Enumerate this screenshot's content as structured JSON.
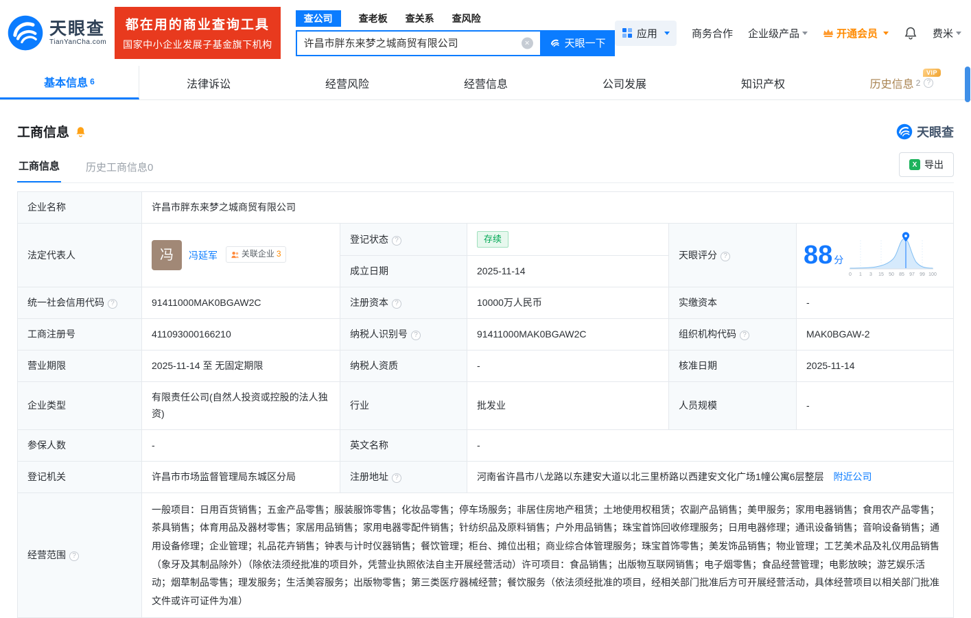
{
  "header": {
    "logo": {
      "brand": "天眼查",
      "domain": "TianYanCha.com"
    },
    "banner": {
      "line1": "都在用的商业查询工具",
      "line2": "国家中小企业发展子基金旗下机构"
    },
    "search": {
      "tabs": [
        {
          "label": "查公司"
        },
        {
          "label": "查老板"
        },
        {
          "label": "查关系"
        },
        {
          "label": "查风险"
        }
      ],
      "value": "许昌市胖东来梦之城商贸有限公司",
      "button": "天眼一下"
    },
    "nav": {
      "apps": "应用",
      "cooperation": "商务合作",
      "enterprise": "企业级产品",
      "vip": "开通会员",
      "user": "费米"
    }
  },
  "nav_tabs": [
    {
      "label": "基本信息",
      "count": "6"
    },
    {
      "label": "法律诉讼"
    },
    {
      "label": "经营风险"
    },
    {
      "label": "经营信息"
    },
    {
      "label": "公司发展"
    },
    {
      "label": "知识产权"
    },
    {
      "label": "历史信息",
      "count": "2",
      "vip": "VIP"
    }
  ],
  "section": {
    "title": "工商信息",
    "watermark": "天眼查",
    "subtabs": [
      "工商信息",
      "历史工商信息0"
    ],
    "export": "导出"
  },
  "fields": {
    "company_name": {
      "label": "企业名称",
      "value": "许昌市胖东来梦之城商贸有限公司"
    },
    "legal_rep": {
      "label": "法定代表人",
      "avatar": "冯",
      "name": "冯延军",
      "related": "关联企业",
      "related_count": "3"
    },
    "reg_status": {
      "label": "登记状态",
      "value": "存续"
    },
    "establish_date": {
      "label": "成立日期",
      "value": "2025-11-14"
    },
    "score": {
      "label": "天眼评分",
      "value": "88",
      "unit": "分"
    },
    "credit_code": {
      "label": "统一社会信用代码",
      "value": "91411000MAK0BGAW2C"
    },
    "reg_capital": {
      "label": "注册资本",
      "value": "10000万人民币"
    },
    "paid_capital": {
      "label": "实缴资本",
      "value": "-"
    },
    "reg_number": {
      "label": "工商注册号",
      "value": "411093000166210"
    },
    "taxpayer_id": {
      "label": "纳税人识别号",
      "value": "91411000MAK0BGAW2C"
    },
    "org_code": {
      "label": "组织机构代码",
      "value": "MAK0BGAW-2"
    },
    "business_term": {
      "label": "营业期限",
      "value": "2025-11-14 至 无固定期限"
    },
    "taxpayer_quality": {
      "label": "纳税人资质",
      "value": "-"
    },
    "approval_date": {
      "label": "核准日期",
      "value": "2025-11-14"
    },
    "company_type": {
      "label": "企业类型",
      "value": "有限责任公司(自然人投资或控股的法人独资)"
    },
    "industry": {
      "label": "行业",
      "value": "批发业"
    },
    "staff_size": {
      "label": "人员规模",
      "value": "-"
    },
    "insured_count": {
      "label": "参保人数",
      "value": "-"
    },
    "english_name": {
      "label": "英文名称",
      "value": "-"
    },
    "reg_authority": {
      "label": "登记机关",
      "value": "许昌市市场监督管理局东城区分局"
    },
    "reg_address": {
      "label": "注册地址",
      "value": "河南省许昌市八龙路以东建安大道以北三里桥路以西建安文化广场1幢公寓6层整层",
      "link": "附近公司"
    },
    "business_scope": {
      "label": "经营范围",
      "value": "一般项目：日用百货销售；五金产品零售；服装服饰零售；化妆品零售；停车场服务；非居住房地产租赁；土地使用权租赁；农副产品销售；美甲服务；家用电器销售；食用农产品零售；茶具销售；体育用品及器材零售；家居用品销售；家用电器零配件销售；针纺织品及原料销售；户外用品销售；珠宝首饰回收修理服务；日用电器修理；通讯设备销售；音响设备销售；通用设备修理；企业管理；礼品花卉销售；钟表与计时仪器销售；餐饮管理；柜台、摊位出租；商业综合体管理服务；珠宝首饰零售；美发饰品销售；物业管理；工艺美术品及礼仪用品销售（象牙及其制品除外）（除依法须经批准的项目外，凭营业执照依法自主开展经营活动）许可项目：食品销售；出版物互联网销售；电子烟零售；食品经营管理；电影放映；游艺娱乐活动；烟草制品零售；理发服务；生活美容服务；出版物零售；第三类医疗器械经营；餐饮服务（依法须经批准的项目，经相关部门批准后方可开展经营活动，具体经营项目以相关部门批准文件或许可证件为准）"
    }
  },
  "score_chart": {
    "ticks": [
      "0",
      "1",
      "3",
      "15",
      "50",
      "85",
      "97",
      "99",
      "100"
    ],
    "marker_value": "88"
  },
  "icons": {
    "help": "?",
    "clear": "×",
    "excel": "X"
  },
  "colors": {
    "brand_blue": "#0b7cff",
    "banner_red": "#e83a1e",
    "status_green": "#00a854",
    "vip_orange": "#ff8a00"
  }
}
